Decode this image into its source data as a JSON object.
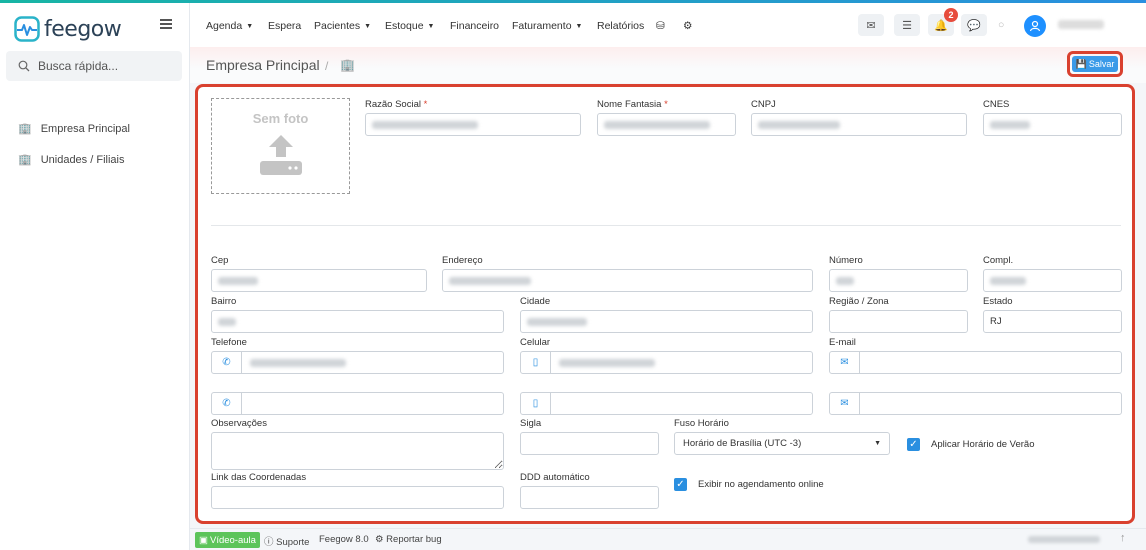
{
  "brand": {
    "name": "feegow",
    "color": "#2a8fe0"
  },
  "sidebar": {
    "search_placeholder": "Busca rápida...",
    "items": [
      {
        "label": "Empresa Principal",
        "icon": "building-icon"
      },
      {
        "label": "Unidades / Filiais",
        "icon": "building-icon"
      }
    ]
  },
  "topnav": {
    "items": [
      {
        "label": "Agenda",
        "dropdown": true
      },
      {
        "label": "Espera",
        "dropdown": false
      },
      {
        "label": "Pacientes",
        "dropdown": true
      },
      {
        "label": "Estoque",
        "dropdown": true
      },
      {
        "label": "Financeiro",
        "dropdown": false
      },
      {
        "label": "Faturamento",
        "dropdown": true
      },
      {
        "label": "Relatórios",
        "dropdown": false
      }
    ],
    "notification_count": "2"
  },
  "header": {
    "title": "Empresa Principal",
    "separator": "/",
    "save_label": "Salvar"
  },
  "form": {
    "photo_label": "Sem foto",
    "labels": {
      "razao_social": "Razão Social",
      "nome_fantasia": "Nome Fantasia",
      "cnpj": "CNPJ",
      "cnes": "CNES",
      "cep": "Cep",
      "endereco": "Endereço",
      "numero": "Número",
      "compl": "Compl.",
      "bairro": "Bairro",
      "cidade": "Cidade",
      "regiao": "Região / Zona",
      "estado": "Estado",
      "telefone": "Telefone",
      "celular": "Celular",
      "email": "E-mail",
      "observacoes": "Observações",
      "sigla": "Sigla",
      "fuso": "Fuso Horário",
      "link": "Link das Coordenadas",
      "ddd": "DDD automático"
    },
    "required_mark": "*",
    "estado_value": "RJ",
    "fuso_value": "Horário de Brasília (UTC -3)",
    "horario_verao_label": "Aplicar Horário de Verão",
    "agendamento_label": "Exibir no agendamento online",
    "horario_verao_checked": true,
    "agendamento_checked": true
  },
  "footer": {
    "video_label": "Vídeo-aula",
    "suporte_label": "Suporte",
    "version_label": "Feegow 8.0",
    "bug_label": "Reportar bug"
  },
  "colors": {
    "accent": "#2a8fe0",
    "highlight_border": "#d9412f",
    "video_green": "#5cc45a"
  }
}
